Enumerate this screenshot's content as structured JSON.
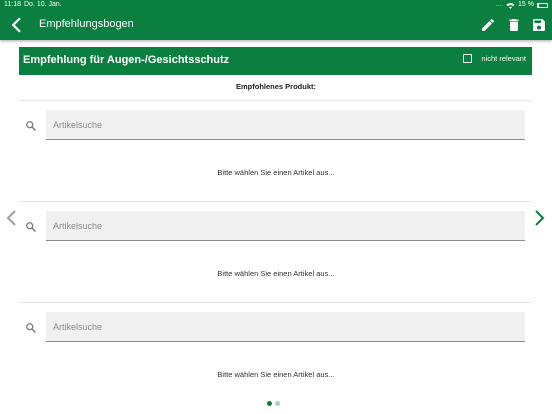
{
  "colors": {
    "brand": "#0a7f3f",
    "arrow_prev": "#9e9e9e",
    "arrow_next": "#0a7f3f"
  },
  "status_bar": {
    "time": "11:18",
    "date": "Do. 10. Jan.",
    "signal_dots": "....",
    "battery_percent": "15 %",
    "battery_level": 0.15
  },
  "app_bar": {
    "back_icon": "chevron-left-icon",
    "title": "Empfehlungsbogen",
    "actions": [
      "pencil-icon",
      "trash-icon",
      "floppy-disk-icon"
    ]
  },
  "section": {
    "title": "Empfehlung für Augen-/Gesichtsschutz",
    "not_relevant_label": "nicht relevant",
    "not_relevant_checked": false
  },
  "recommended_label": "Empfohlenes Produkt:",
  "products": [
    {
      "search_placeholder": "Artikelsuche",
      "search_value": "",
      "hint": "Bitte wählen Sie einen Artikel aus..."
    },
    {
      "search_placeholder": "Artikelsuche",
      "search_value": "",
      "hint": "Bitte wählen Sie einen Artikel aus..."
    },
    {
      "search_placeholder": "Artikelsuche",
      "search_value": "",
      "hint": "Bitte wählen Sie einen Artikel aus..."
    }
  ],
  "pagination": {
    "pages": 2,
    "current": 1
  }
}
